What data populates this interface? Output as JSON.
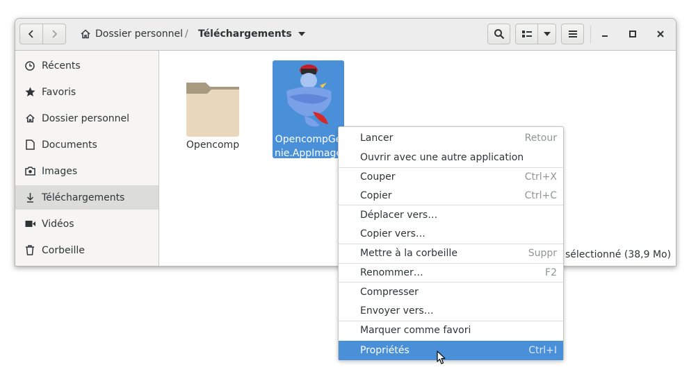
{
  "header": {
    "back_icon": "chevron-left-icon",
    "forward_icon": "chevron-right-icon",
    "breadcrumb_home": "Dossier personnel",
    "breadcrumb_separator": "/",
    "breadcrumb_current": "Téléchargements",
    "search_icon": "search-icon",
    "view_icon": "grid-view-icon",
    "menu_icon": "hamburger-menu-icon"
  },
  "sidebar": {
    "items": [
      {
        "label": "Récents",
        "icon": "clock-icon"
      },
      {
        "label": "Favoris",
        "icon": "star-icon"
      },
      {
        "label": "Dossier personnel",
        "icon": "home-icon"
      },
      {
        "label": "Documents",
        "icon": "document-icon"
      },
      {
        "label": "Images",
        "icon": "camera-icon"
      },
      {
        "label": "Téléchargements",
        "icon": "download-icon",
        "active": true
      },
      {
        "label": "Vidéos",
        "icon": "video-icon"
      },
      {
        "label": "Corbeille",
        "icon": "trash-icon"
      }
    ]
  },
  "files": [
    {
      "name": "Opencomp",
      "icon": "folder-icon"
    },
    {
      "name_line1": "OpencompGe",
      "name_line2": "nie.AppImage",
      "icon": "genie-app-icon",
      "selected": true
    }
  ],
  "status": {
    "text": "sélectionné  (38,9 Mo)"
  },
  "context_menu": {
    "items": [
      {
        "label": "Lancer",
        "accel": "Retour"
      },
      {
        "label": "Ouvrir avec une autre application",
        "accel": ""
      },
      {
        "label": "Couper",
        "accel": "Ctrl+X"
      },
      {
        "label": "Copier",
        "accel": "Ctrl+C"
      },
      {
        "label": "Déplacer vers…",
        "accel": ""
      },
      {
        "label": "Copier vers…",
        "accel": ""
      },
      {
        "label": "Mettre à la corbeille",
        "accel": "Suppr"
      },
      {
        "label": "Renommer…",
        "accel": "F2"
      },
      {
        "label": "Compresser",
        "accel": ""
      },
      {
        "label": "Envoyer vers…",
        "accel": ""
      },
      {
        "label": "Marquer comme favori",
        "accel": ""
      },
      {
        "label": "Propriétés",
        "accel": "Ctrl+I",
        "highlighted": true
      }
    ]
  },
  "colors": {
    "selection": "#4a90d9",
    "headerbar": "#ededed",
    "sidebar": "#f6f5f4"
  }
}
